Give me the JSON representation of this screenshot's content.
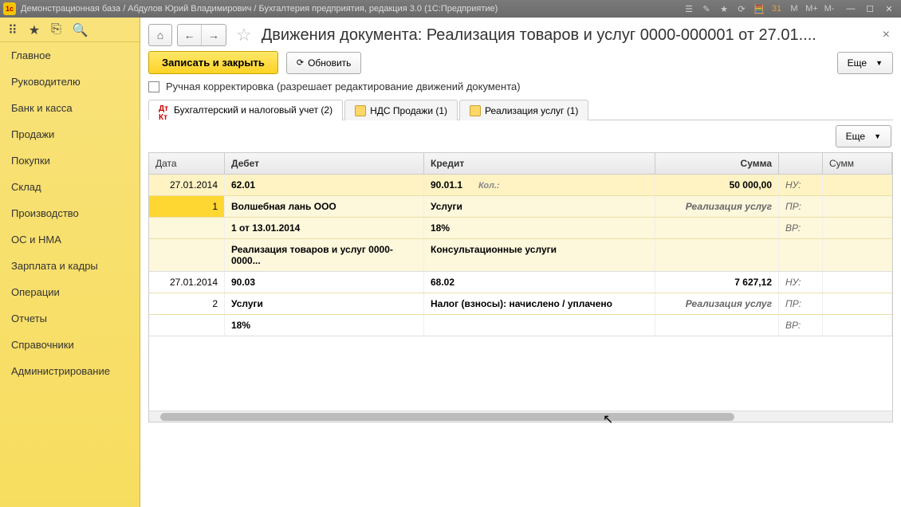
{
  "window": {
    "title": "Демонстрационная база / Абдулов Юрий Владимирович / Бухгалтерия предприятия, редакция 3.0  (1С:Предприятие)"
  },
  "sidebar": {
    "items": [
      "Главное",
      "Руководителю",
      "Банк и касса",
      "Продажи",
      "Покупки",
      "Склад",
      "Производство",
      "ОС и НМА",
      "Зарплата и кадры",
      "Операции",
      "Отчеты",
      "Справочники",
      "Администрирование"
    ]
  },
  "page": {
    "title": "Движения документа: Реализация товаров и услуг 0000-000001 от 27.01....",
    "save_close": "Записать и закрыть",
    "refresh": "Обновить",
    "more": "Еще",
    "manual_edit": "Ручная корректировка (разрешает редактирование движений документа)"
  },
  "tabs": [
    {
      "label": "Бухгалтерский и налоговый учет (2)"
    },
    {
      "label": "НДС Продажи (1)"
    },
    {
      "label": "Реализация услуг (1)"
    }
  ],
  "grid": {
    "more": "Еще",
    "headers": {
      "date": "Дата",
      "debit": "Дебет",
      "credit": "Кредит",
      "sum": "Сумма",
      "sum2": "Сумм"
    },
    "rows": [
      {
        "hl": true,
        "date": "27.01.2014",
        "n": "1",
        "debit": "62.01",
        "credit": "90.01.1",
        "kol": "Кол.:",
        "sum": "50 000,00",
        "tag": "НУ:",
        "sub": [
          {
            "debit": "Волшебная лань ООО",
            "credit": "Услуги",
            "sum_txt": "Реализация услуг",
            "tag": "ПР:"
          },
          {
            "debit": "1 от 13.01.2014",
            "credit": "18%",
            "tag": "ВР:"
          },
          {
            "debit": "Реализация товаров и услуг 0000-0000...",
            "credit": "Консультационные услуги"
          }
        ]
      },
      {
        "hl": false,
        "date": "27.01.2014",
        "n": "2",
        "debit": "90.03",
        "credit": "68.02",
        "sum": "7 627,12",
        "tag": "НУ:",
        "sub": [
          {
            "debit": "Услуги",
            "credit": "Налог (взносы): начислено / уплачено",
            "sum_txt": "Реализация услуг",
            "tag": "ПР:"
          },
          {
            "debit": "18%",
            "credit": "",
            "tag": "ВР:"
          }
        ]
      }
    ]
  }
}
